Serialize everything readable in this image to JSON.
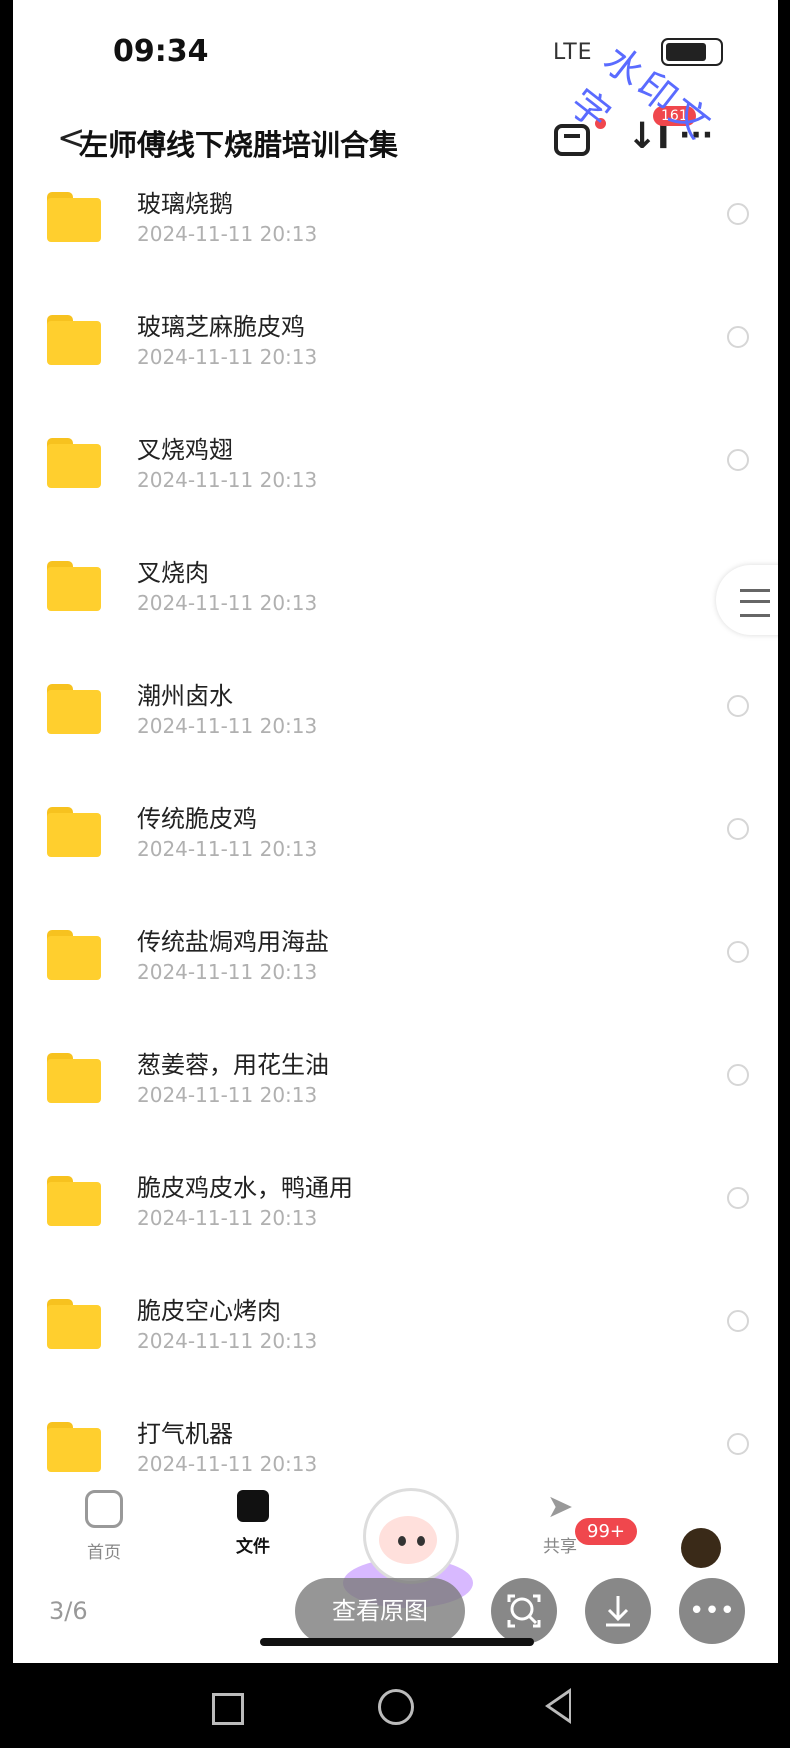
{
  "status_bar": {
    "time": "09:34",
    "signal": "LTE"
  },
  "header": {
    "back_glyph": "<",
    "title": "左师傅线下烧腊培训合集",
    "notification_count": "161",
    "watermark": "水印文字"
  },
  "files": [
    {
      "name": "玻璃烧鹅",
      "date": "2024-11-11 20:13"
    },
    {
      "name": "玻璃芝麻脆皮鸡",
      "date": "2024-11-11 20:13"
    },
    {
      "name": "叉烧鸡翅",
      "date": "2024-11-11 20:13"
    },
    {
      "name": "叉烧肉",
      "date": "2024-11-11 20:13"
    },
    {
      "name": "潮州卤水",
      "date": "2024-11-11 20:13"
    },
    {
      "name": "传统脆皮鸡",
      "date": "2024-11-11 20:13"
    },
    {
      "name": "传统盐焗鸡用海盐",
      "date": "2024-11-11 20:13"
    },
    {
      "name": "葱姜蓉，用花生油",
      "date": "2024-11-11 20:13"
    },
    {
      "name": "脆皮鸡皮水，鸭通用",
      "date": "2024-11-11 20:13"
    },
    {
      "name": "脆皮空心烤肉",
      "date": "2024-11-11 20:13"
    },
    {
      "name": "打气机器",
      "date": "2024-11-11 20:13"
    }
  ],
  "tabbar": {
    "home": "首页",
    "files": "文件",
    "share": "共享",
    "share_badge": "99+"
  },
  "viewer": {
    "page_indicator": "3/6",
    "view_original": "查看原图",
    "more_glyph": "•••"
  },
  "colors": {
    "folder": "#ffcf2e",
    "badge": "#f0474d",
    "watermark": "#5a6bff"
  }
}
